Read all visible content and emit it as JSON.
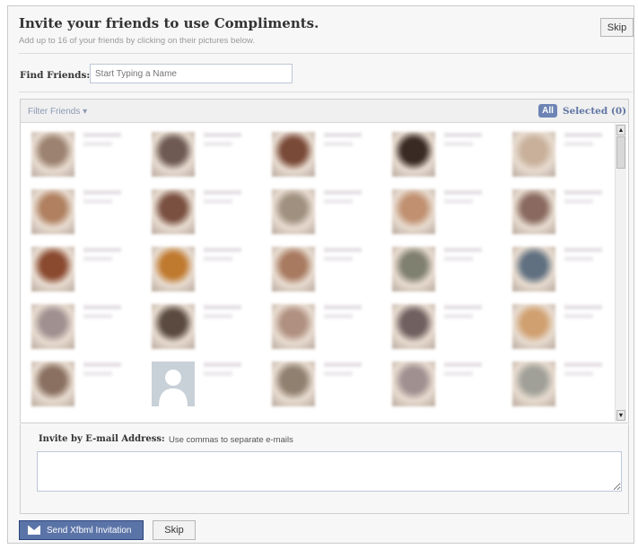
{
  "header": {
    "title": "Invite your friends to use Compliments.",
    "subtitle": "Add up to 16 of your friends by clicking on their pictures below.",
    "skip_label": "Skip"
  },
  "find": {
    "label": "Find Friends:",
    "placeholder": "Start Typing a Name"
  },
  "filterbar": {
    "filter_label": "Filter Friends ▾",
    "all_label": "All",
    "selected_label": "Selected (0)"
  },
  "friends": {
    "photo_colors": [
      "#9c8270",
      "#6e5a52",
      "#7a4a38",
      "#3a2a24",
      "#c8b09a",
      "#b08060",
      "#7a5040",
      "#a09080",
      "#c09070",
      "#8a6a60",
      "#8a4a30",
      "#c07a30",
      "#a87a60",
      "#808070",
      "#607080",
      "#a09090",
      "#5a4a40",
      "#b09080",
      "#706060",
      "#d0a070",
      "#8a7060",
      "#c8d0d8",
      "#908070",
      "#a09090",
      "#a0a098"
    ],
    "default_photo_index": 21
  },
  "email": {
    "label": "Invite by E-mail Address:",
    "hint": "Use commas to separate e-mails"
  },
  "footer": {
    "send_label": "Send Xfbml Invitation",
    "skip_label": "Skip"
  },
  "icons": {
    "send": "envelope-icon",
    "filter": "chevron-down-icon"
  },
  "colors": {
    "accent": "#6d84b4",
    "button": "#5b74a8"
  }
}
